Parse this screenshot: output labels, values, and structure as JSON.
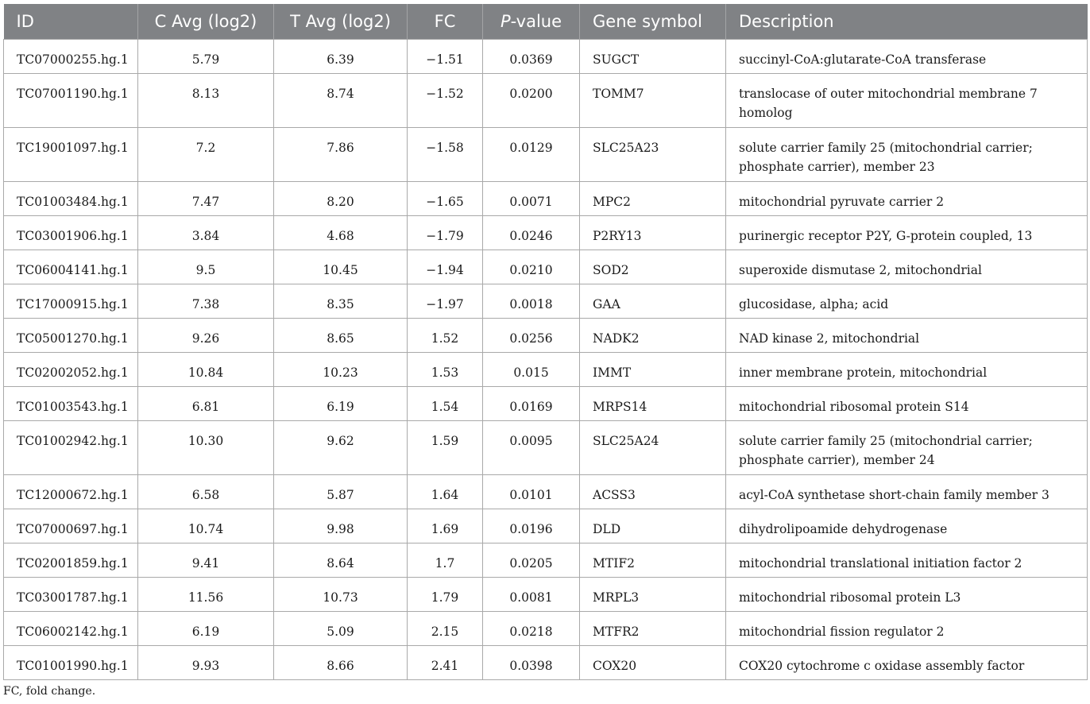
{
  "table": {
    "headers": {
      "id": "ID",
      "c_avg": "C Avg (log2)",
      "t_avg": "T Avg (log2)",
      "fc": "FC",
      "p_italic": "P",
      "p_rest": "-value",
      "gene_symbol": "Gene symbol",
      "description": "Description"
    },
    "rows": [
      {
        "id": "TC07000255.hg.1",
        "c_avg": "5.79",
        "t_avg": "6.39",
        "fc": "−1.51",
        "p": "0.0369",
        "gene": "SUGCT",
        "desc": "succinyl-CoA:glutarate-CoA transferase"
      },
      {
        "id": "TC07001190.hg.1",
        "c_avg": "8.13",
        "t_avg": "8.74",
        "fc": "−1.52",
        "p": "0.0200",
        "gene": "TOMM7",
        "desc": "translocase of outer mitochondrial membrane 7 homolog"
      },
      {
        "id": "TC19001097.hg.1",
        "c_avg": "7.2",
        "t_avg": "7.86",
        "fc": "−1.58",
        "p": "0.0129",
        "gene": "SLC25A23",
        "desc": "solute carrier family 25 (mitochondrial carrier; phosphate carrier), member 23"
      },
      {
        "id": "TC01003484.hg.1",
        "c_avg": "7.47",
        "t_avg": "8.20",
        "fc": "−1.65",
        "p": "0.0071",
        "gene": "MPC2",
        "desc": "mitochondrial pyruvate carrier 2"
      },
      {
        "id": "TC03001906.hg.1",
        "c_avg": "3.84",
        "t_avg": "4.68",
        "fc": "−1.79",
        "p": "0.0246",
        "gene": "P2RY13",
        "desc": "purinergic receptor P2Y, G-protein coupled, 13"
      },
      {
        "id": "TC06004141.hg.1",
        "c_avg": "9.5",
        "t_avg": "10.45",
        "fc": "−1.94",
        "p": "0.0210",
        "gene": "SOD2",
        "desc": "superoxide dismutase 2, mitochondrial"
      },
      {
        "id": "TC17000915.hg.1",
        "c_avg": "7.38",
        "t_avg": "8.35",
        "fc": "−1.97",
        "p": "0.0018",
        "gene": "GAA",
        "desc": "glucosidase, alpha; acid"
      },
      {
        "id": "TC05001270.hg.1",
        "c_avg": "9.26",
        "t_avg": "8.65",
        "fc": "1.52",
        "p": "0.0256",
        "gene": "NADK2",
        "desc": "NAD kinase 2, mitochondrial"
      },
      {
        "id": "TC02002052.hg.1",
        "c_avg": "10.84",
        "t_avg": "10.23",
        "fc": "1.53",
        "p": "0.015",
        "gene": "IMMT",
        "desc": "inner membrane protein, mitochondrial"
      },
      {
        "id": "TC01003543.hg.1",
        "c_avg": "6.81",
        "t_avg": "6.19",
        "fc": "1.54",
        "p": "0.0169",
        "gene": "MRPS14",
        "desc": "mitochondrial ribosomal protein S14"
      },
      {
        "id": "TC01002942.hg.1",
        "c_avg": "10.30",
        "t_avg": "9.62",
        "fc": "1.59",
        "p": "0.0095",
        "gene": "SLC25A24",
        "desc": "solute carrier family 25 (mitochondrial carrier; phosphate carrier), member 24"
      },
      {
        "id": "TC12000672.hg.1",
        "c_avg": "6.58",
        "t_avg": "5.87",
        "fc": "1.64",
        "p": "0.0101",
        "gene": "ACSS3",
        "desc": "acyl-CoA synthetase short-chain family member 3"
      },
      {
        "id": "TC07000697.hg.1",
        "c_avg": "10.74",
        "t_avg": "9.98",
        "fc": "1.69",
        "p": "0.0196",
        "gene": "DLD",
        "desc": "dihydrolipoamide dehydrogenase"
      },
      {
        "id": "TC02001859.hg.1",
        "c_avg": "9.41",
        "t_avg": "8.64",
        "fc": "1.7",
        "p": "0.0205",
        "gene": "MTIF2",
        "desc": "mitochondrial translational initiation factor 2"
      },
      {
        "id": "TC03001787.hg.1",
        "c_avg": "11.56",
        "t_avg": "10.73",
        "fc": "1.79",
        "p": "0.0081",
        "gene": "MRPL3",
        "desc": "mitochondrial ribosomal protein L3"
      },
      {
        "id": "TC06002142.hg.1",
        "c_avg": "6.19",
        "t_avg": "5.09",
        "fc": "2.15",
        "p": "0.0218",
        "gene": "MTFR2",
        "desc": "mitochondrial fission regulator 2"
      },
      {
        "id": "TC01001990.hg.1",
        "c_avg": "9.93",
        "t_avg": "8.66",
        "fc": "2.41",
        "p": "0.0398",
        "gene": "COX20",
        "desc": "COX20 cytochrome c oxidase assembly factor"
      }
    ]
  },
  "footnote": "FC, fold change.",
  "colors": {
    "header_bg": "#808285",
    "header_text": "#ffffff",
    "grid": "#a9a9a9",
    "body_text": "#1a1a1a"
  }
}
